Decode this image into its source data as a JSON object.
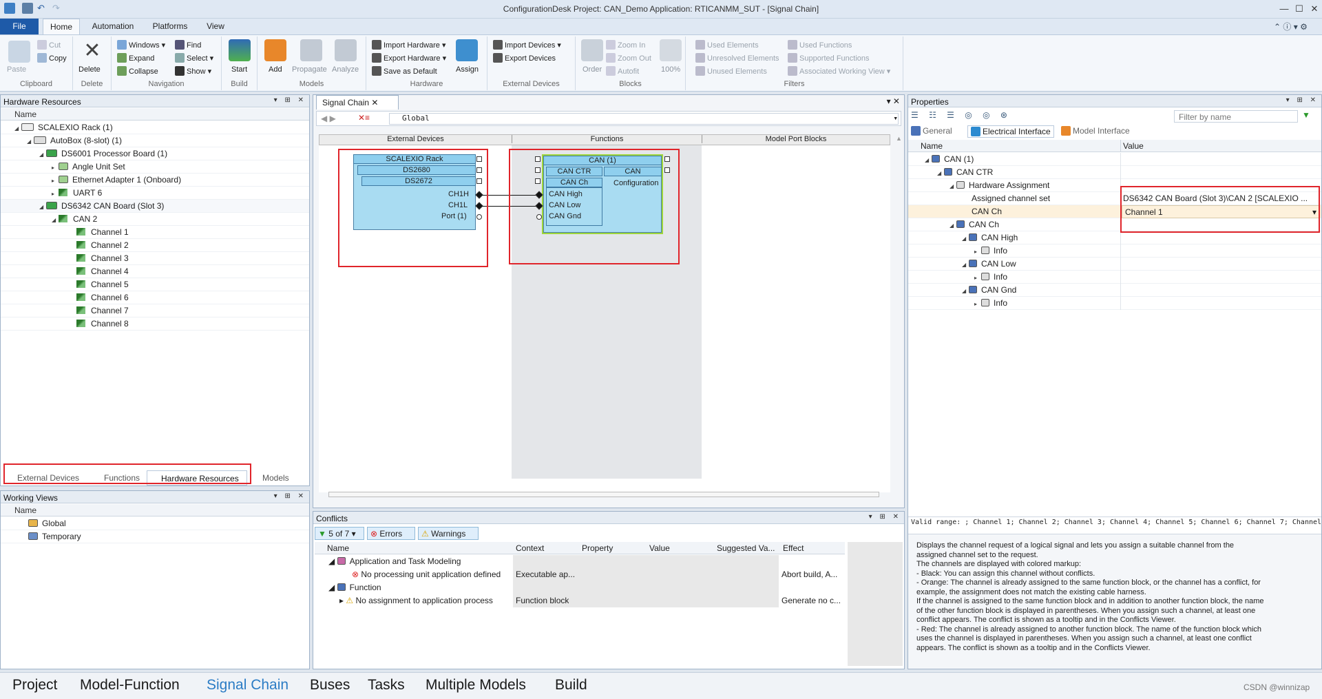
{
  "window": {
    "title": "ConfigurationDesk  Project: CAN_Demo Application: RTICANMM_SUT - [Signal Chain]"
  },
  "ribbon_tabs": [
    "File",
    "Home",
    "Automation",
    "Platforms",
    "View"
  ],
  "ribbon": {
    "clipboard": {
      "paste": "Paste",
      "cut": "Cut",
      "copy": "Copy",
      "label": "Clipboard"
    },
    "delete": {
      "delete": "Delete",
      "label": "Delete"
    },
    "navigation": {
      "windows": "Windows",
      "find": "Find",
      "expand": "Expand",
      "select": "Select",
      "collapse": "Collapse",
      "show": "Show",
      "label": "Navigation"
    },
    "build": {
      "start": "Start",
      "label": "Build"
    },
    "models": {
      "add": "Add",
      "propagate": "Propagate",
      "analyze": "Analyze",
      "label": "Models"
    },
    "hardware": {
      "import": "Import Hardware",
      "export": "Export Hardware",
      "save_default": "Save as Default",
      "assign": "Assign",
      "label": "Hardware"
    },
    "external_devices": {
      "import": "Import Devices",
      "export": "Export Devices",
      "label": "External Devices"
    },
    "blocks": {
      "order": "Order",
      "zoom_in": "Zoom In",
      "zoom_out": "Zoom Out",
      "autofit": "Autofit",
      "zoom": "100%",
      "label": "Blocks"
    },
    "filters": {
      "used_elements": "Used Elements",
      "unresolved": "Unresolved Elements",
      "unused": "Unused Elements",
      "used_functions": "Used Functions",
      "supported": "Supported Functions",
      "assoc_view": "Associated Working View",
      "label": "Filters"
    }
  },
  "hw_panel": {
    "title": "Hardware Resources",
    "col": "Name",
    "rows": [
      "SCALEXIO Rack (1)",
      "AutoBox (8-slot) (1)",
      "DS6001 Processor Board (1)",
      "Angle Unit Set",
      "Ethernet Adapter 1 (Onboard)",
      "UART 6",
      "DS6342 CAN Board (Slot 3)",
      "CAN 2",
      "Channel 1",
      "Channel 2",
      "Channel 3",
      "Channel 4",
      "Channel 5",
      "Channel 6",
      "Channel 7",
      "Channel 8"
    ],
    "tabs": [
      "External Devices",
      "Functions",
      "Hardware Resources",
      "Models"
    ]
  },
  "working_views": {
    "title": "Working Views",
    "col": "Name",
    "rows": [
      "Global",
      "Temporary"
    ]
  },
  "signal_chain": {
    "tab": "Signal Chain",
    "view": "Global",
    "columns": [
      "External Devices",
      "Functions",
      "Model Port Blocks"
    ],
    "ext": {
      "rack": "SCALEXIO Rack",
      "b1": "DS2680",
      "b2": "DS2672",
      "p1": "CH1H",
      "p2": "CH1L",
      "p3": "Port (1)"
    },
    "fn": {
      "can": "CAN (1)",
      "ctr": "CAN CTR",
      "can2": "CAN",
      "cfg": "Configuration",
      "ch": "CAN Ch",
      "p1": "CAN High",
      "p2": "CAN Low",
      "p3": "CAN Gnd"
    }
  },
  "conflicts": {
    "title": "Conflicts",
    "count": "5 of 7",
    "errors": "Errors",
    "warnings": "Warnings",
    "cols": [
      "Name",
      "Context",
      "Property",
      "Value",
      "Suggested Va...",
      "Effect"
    ],
    "rows": [
      {
        "name": "Application and Task Modeling",
        "context": "",
        "effect": ""
      },
      {
        "name": "No processing unit application defined",
        "context": "Executable ap...",
        "effect": "Abort build, A..."
      },
      {
        "name": "Function",
        "context": "",
        "effect": ""
      },
      {
        "name": "No assignment to application process",
        "context": "Function block",
        "effect": "Generate no c..."
      }
    ]
  },
  "properties": {
    "title": "Properties",
    "filter": "Filter by name",
    "tabs": [
      "General",
      "Electrical Interface",
      "Model Interface"
    ],
    "cols": [
      "Name",
      "Value"
    ],
    "rows": [
      {
        "n": "CAN (1)",
        "v": ""
      },
      {
        "n": "CAN CTR",
        "v": ""
      },
      {
        "n": "Hardware Assignment",
        "v": ""
      },
      {
        "n": "Assigned channel set",
        "v": "DS6342 CAN Board (Slot 3)\\CAN 2 [SCALEXIO ..."
      },
      {
        "n": "CAN Ch",
        "v": "Channel 1"
      },
      {
        "n": "CAN Ch",
        "v": ""
      },
      {
        "n": "CAN High",
        "v": ""
      },
      {
        "n": "Info",
        "v": ""
      },
      {
        "n": "CAN Low",
        "v": ""
      },
      {
        "n": "Info",
        "v": ""
      },
      {
        "n": "CAN Gnd",
        "v": ""
      },
      {
        "n": "Info",
        "v": ""
      }
    ],
    "valid": "Valid range: ; Channel 1; Channel 2; Channel 3; Channel 4; Channel 5; Channel 6; Channel 7; Channel",
    "desc": [
      "Displays the channel request of a logical signal and lets you assign a suitable channel from the",
      "assigned channel set to the request.",
      "The channels are displayed with colored markup:",
      "- Black: You can assign this channel without conflicts.",
      "- Orange: The channel is already assigned to the same function block, or the channel has a conflict, for",
      "example, the assignment does not match the existing cable harness.",
      "If the channel is assigned to the same function block and in addition to another function block, the name",
      "of the other function block is displayed in parentheses. When you assign such a channel, at least one",
      "conflict appears. The conflict is shown as a tooltip and in the Conflicts Viewer.",
      "- Red: The channel is already assigned to another function block. The name of the function block which",
      "uses the channel is displayed in parentheses. When you assign such a channel, at least one conflict",
      "appears. The conflict is shown as a tooltip and in the Conflicts Viewer."
    ]
  },
  "bottom_tabs": [
    "Project",
    "Model-Function",
    "Signal Chain",
    "Buses",
    "Tasks",
    "Multiple Models",
    "Build"
  ],
  "watermark": "CSDN @winnizap"
}
